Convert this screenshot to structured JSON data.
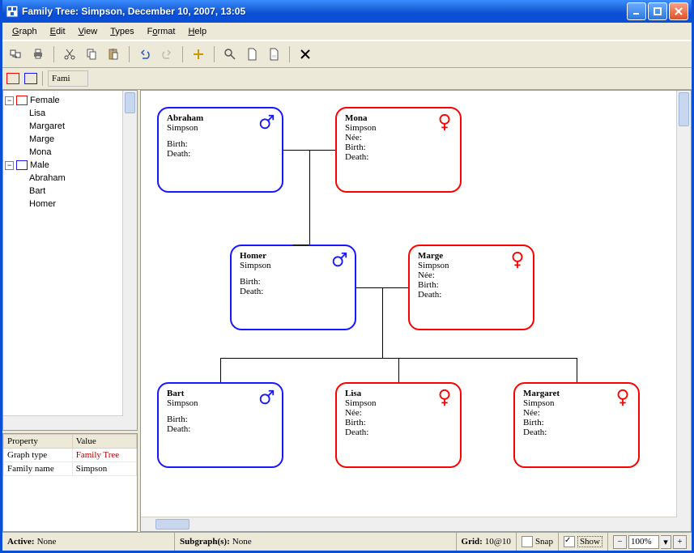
{
  "window": {
    "title": "Family Tree: Simpson, December 10, 2007, 13:05"
  },
  "menu": [
    "Graph",
    "Edit",
    "View",
    "Types",
    "Format",
    "Help"
  ],
  "menu_hot": [
    "G",
    "E",
    "V",
    "T",
    "o",
    "H"
  ],
  "toolbar2": {
    "typed": "Fami"
  },
  "tree": {
    "female": {
      "label": "Female",
      "children": [
        "Lisa",
        "Margaret",
        "Marge",
        "Mona"
      ]
    },
    "male": {
      "label": "Male",
      "children": [
        "Abraham",
        "Bart",
        "Homer"
      ]
    }
  },
  "props": {
    "headers": [
      "Property",
      "Value"
    ],
    "rows": [
      {
        "k": "Graph type",
        "v": "Family Tree",
        "red": true
      },
      {
        "k": "Family name",
        "v": "Simpson",
        "red": false
      }
    ]
  },
  "people": {
    "abraham": {
      "first": "Abraham",
      "last": "Simpson",
      "sex": "male",
      "nee": "",
      "birth": "",
      "death": ""
    },
    "mona": {
      "first": "Mona",
      "last": "Simpson",
      "sex": "female",
      "nee": "",
      "birth": "",
      "death": ""
    },
    "homer": {
      "first": "Homer",
      "last": "Simpson",
      "sex": "male",
      "nee": "",
      "birth": "",
      "death": ""
    },
    "marge": {
      "first": "Marge",
      "last": "Simpson",
      "sex": "female",
      "nee": "",
      "birth": "",
      "death": ""
    },
    "bart": {
      "first": "Bart",
      "last": "Simpson",
      "sex": "male",
      "nee": "",
      "birth": "",
      "death": ""
    },
    "lisa": {
      "first": "Lisa",
      "last": "Simpson",
      "sex": "female",
      "nee": "",
      "birth": "",
      "death": ""
    },
    "margaret": {
      "first": "Margaret",
      "last": "Simpson",
      "sex": "female",
      "nee": "",
      "birth": "",
      "death": ""
    }
  },
  "labels": {
    "nee": "Née:",
    "birth": "Birth:",
    "death": "Death:"
  },
  "status": {
    "active_label": "Active:",
    "active": "None",
    "subgraph_label": "Subgraph(s):",
    "subgraph": "None",
    "grid_label": "Grid:",
    "grid": "10@10",
    "snap": "Snap",
    "show": "Show",
    "show_on": true,
    "zoom": "100%"
  }
}
